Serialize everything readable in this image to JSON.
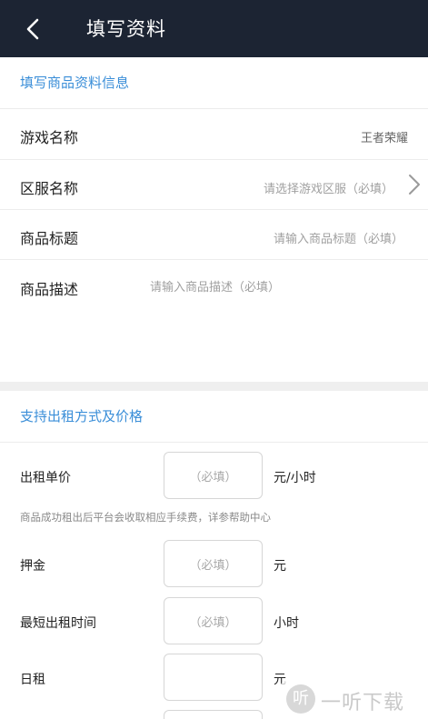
{
  "header": {
    "title": "填写资料",
    "back_icon": "chevron-left-icon"
  },
  "goods_section": {
    "title": "填写商品资料信息",
    "game_name": {
      "label": "游戏名称",
      "value": "王者荣耀"
    },
    "server_name": {
      "label": "区服名称",
      "placeholder": "请选择游戏区服（必填）",
      "icon": "chevron-right-icon"
    },
    "goods_title": {
      "label": "商品标题",
      "placeholder": "请输入商品标题（必填）"
    },
    "goods_desc": {
      "label": "商品描述",
      "placeholder": "请输入商品描述（必填）"
    }
  },
  "rent_section": {
    "title": "支持出租方式及价格",
    "unit_price": {
      "label": "出租单价",
      "placeholder": "（必填）",
      "unit": "元/小时"
    },
    "note": "商品成功租出后平台会收取相应手续费，详参帮助中心",
    "deposit": {
      "label": "押金",
      "placeholder": "（必填）",
      "unit": "元"
    },
    "min_time": {
      "label": "最短出租时间",
      "placeholder": "（必填）",
      "unit": "小时"
    },
    "daily": {
      "label": "日租",
      "placeholder": "",
      "unit": "元"
    }
  },
  "watermark": {
    "logo_text": "听",
    "text": "一听下载"
  },
  "colors": {
    "header_bg": "#1c2433",
    "accent": "#3a8ed8",
    "divider": "#ececec"
  }
}
